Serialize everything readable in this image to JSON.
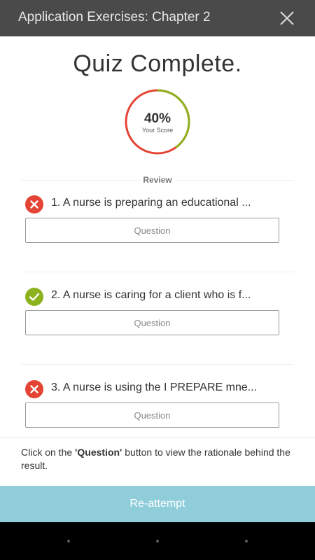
{
  "header": {
    "title": "Application Exercises: Chapter 2",
    "close_icon": "close-icon"
  },
  "main": {
    "heading": "Quiz Complete.",
    "score": {
      "percent_text": "40%",
      "label": "Your Score",
      "value_fraction": 0.4,
      "colors": {
        "correct": "#8cb21d",
        "incorrect": "#e44433"
      }
    },
    "review_label": "Review",
    "items": [
      {
        "text": "1. A nurse is preparing an educational ...",
        "status": "incorrect",
        "button_label": "Question"
      },
      {
        "text": "2. A nurse is caring for a client who is f...",
        "status": "correct",
        "button_label": "Question"
      },
      {
        "text": "3. A nurse is using the I PREPARE mne...",
        "status": "incorrect",
        "button_label": "Question"
      }
    ]
  },
  "footer": {
    "note_prefix": "Click on the ",
    "note_bold": "'Question'",
    "note_suffix": " button to view the rationale behind the result.",
    "reattempt_label": "Re-attempt",
    "accent_color": "#8ecdd9"
  },
  "status_colors": {
    "correct": "#8cb21d",
    "incorrect": "#e44433"
  }
}
